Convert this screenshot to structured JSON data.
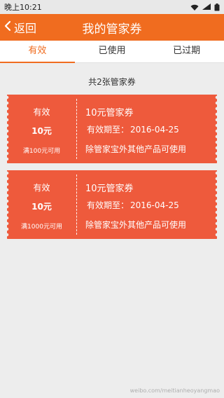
{
  "status_bar": {
    "time": "晚上10:21",
    "battery_level": "full"
  },
  "header": {
    "back_label": "返回",
    "title": "我的管家券"
  },
  "tabs": [
    {
      "label": "有效",
      "active": true
    },
    {
      "label": "已使用",
      "active": false
    },
    {
      "label": "已过期",
      "active": false
    }
  ],
  "summary": "共2张管家券",
  "coupons": [
    {
      "status": "有效",
      "amount": "10元",
      "condition": "满100元可用",
      "title": "10元管家券",
      "expiry_label": "有效期至：",
      "expiry_date": "2016-04-25",
      "description": "除管家宝外其他产品可使用"
    },
    {
      "status": "有效",
      "amount": "10元",
      "condition": "满1000元可用",
      "title": "10元管家券",
      "expiry_label": "有效期至：",
      "expiry_date": "2016-04-25",
      "description": "除管家宝外其他产品可使用"
    }
  ],
  "watermark": "weibo.com/meitianheoyangmao",
  "colors": {
    "accent": "#f06c1f",
    "coupon": "#ee5a3c",
    "background": "#ededed"
  },
  "icons": {
    "back": "chevron-left-icon",
    "wifi": "wifi-icon",
    "signal": "signal-icon",
    "battery": "battery-icon"
  }
}
